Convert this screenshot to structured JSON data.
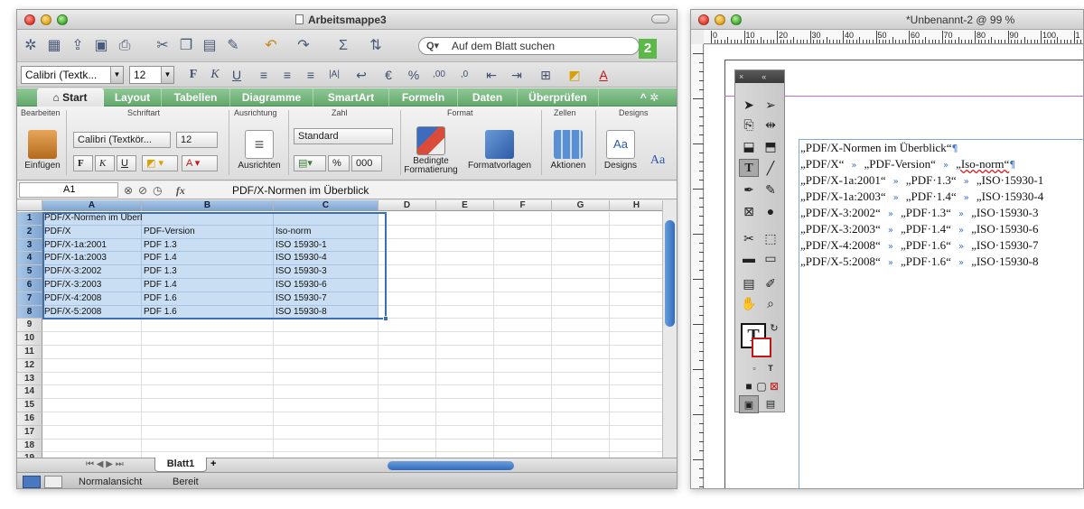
{
  "excel": {
    "window_title": "Arbeitsmappe3",
    "search_placeholder": "Auf dem Blatt suchen",
    "badge": "2",
    "font_name": "Calibri (Textk...",
    "font_size": "12",
    "format_labels": [
      "F",
      "K",
      "U"
    ],
    "ribbon_tabs": [
      "Start",
      "Layout",
      "Tabellen",
      "Diagramme",
      "SmartArt",
      "Formeln",
      "Daten",
      "Überprüfen"
    ],
    "ribbon_groups": [
      "Bearbeiten",
      "Schriftart",
      "Ausrichtung",
      "Zahl",
      "Format",
      "Zellen",
      "Designs"
    ],
    "ribbon": {
      "font_name": "Calibri (Textkör...",
      "font_size": "12",
      "number_format": "Standard",
      "percent": "%",
      "thousands": "000",
      "einfuegen": "Einfügen",
      "ausrichten": "Ausrichten",
      "bedingte": "Bedingte",
      "formatierung": "Formatierung",
      "formatvorlagen": "Formatvorlagen",
      "aktionen": "Aktionen",
      "designs": "Designs",
      "aa": "Aa"
    },
    "cell_ref": "A1",
    "fx": "fx",
    "formula": "PDF/X-Normen im Überblick",
    "columns": [
      "A",
      "B",
      "C",
      "D",
      "E",
      "F",
      "G",
      "H"
    ],
    "rows": [
      [
        "PDF/X-Normen im Überblick",
        "",
        ""
      ],
      [
        "PDF/X",
        "PDF-Version",
        "Iso-norm"
      ],
      [
        "PDF/X-1a:2001",
        "PDF 1.3",
        "ISO 15930-1"
      ],
      [
        "PDF/X-1a:2003",
        "PDF 1.4",
        "ISO 15930-4"
      ],
      [
        "PDF/X-3:2002",
        "PDF 1.3",
        "ISO 15930-3"
      ],
      [
        "PDF/X-3:2003",
        "PDF 1.4",
        "ISO 15930-6"
      ],
      [
        "PDF/X-4:2008",
        "PDF 1.6",
        "ISO 15930-7"
      ],
      [
        "PDF/X-5:2008",
        "PDF 1.6",
        "ISO 15930-8"
      ]
    ],
    "row_numbers": [
      "1",
      "2",
      "3",
      "4",
      "5",
      "6",
      "7",
      "8",
      "9",
      "10",
      "11",
      "12",
      "13",
      "14",
      "15",
      "16",
      "17",
      "18",
      "19"
    ],
    "sheet_tab": "Blatt1",
    "status_view": "Normalansicht",
    "status_ready": "Bereit"
  },
  "indesign": {
    "window_title": "*Unbenannt-2 @ 99 %",
    "ruler_numbers": [
      "0",
      "10",
      "20",
      "30",
      "40",
      "50",
      "60",
      "70",
      "80",
      "90",
      "100",
      "1"
    ],
    "lines": [
      {
        "c1": "„PDF/X-Normen im Überblick“",
        "c2": "",
        "c3": "",
        "pil": "¶"
      },
      {
        "c1": "„PDF/X“",
        "c2": "„PDF-Version“",
        "c3": "„Iso-norm“",
        "pil": "¶"
      },
      {
        "c1": "„PDF/X-1a:2001“",
        "c2": "„PDF·1.3“",
        "c3": "„ISO·15930-1",
        "pil": ""
      },
      {
        "c1": "„PDF/X-1a:2003“",
        "c2": "„PDF·1.4“",
        "c3": "„ISO·15930-4",
        "pil": ""
      },
      {
        "c1": "„PDF/X-3:2002“",
        "c2": "„PDF·1.3“",
        "c3": "„ISO·15930-3",
        "pil": ""
      },
      {
        "c1": "„PDF/X-3:2003“",
        "c2": "„PDF·1.4“",
        "c3": "„ISO·15930-6",
        "pil": ""
      },
      {
        "c1": "„PDF/X-4:2008“",
        "c2": "„PDF·1.6“",
        "c3": "„ISO·15930-7",
        "pil": ""
      },
      {
        "c1": "„PDF/X-5:2008“",
        "c2": "„PDF·1.6“",
        "c3": "„ISO·15930-8",
        "pil": ""
      }
    ],
    "tab_marker": "»"
  }
}
